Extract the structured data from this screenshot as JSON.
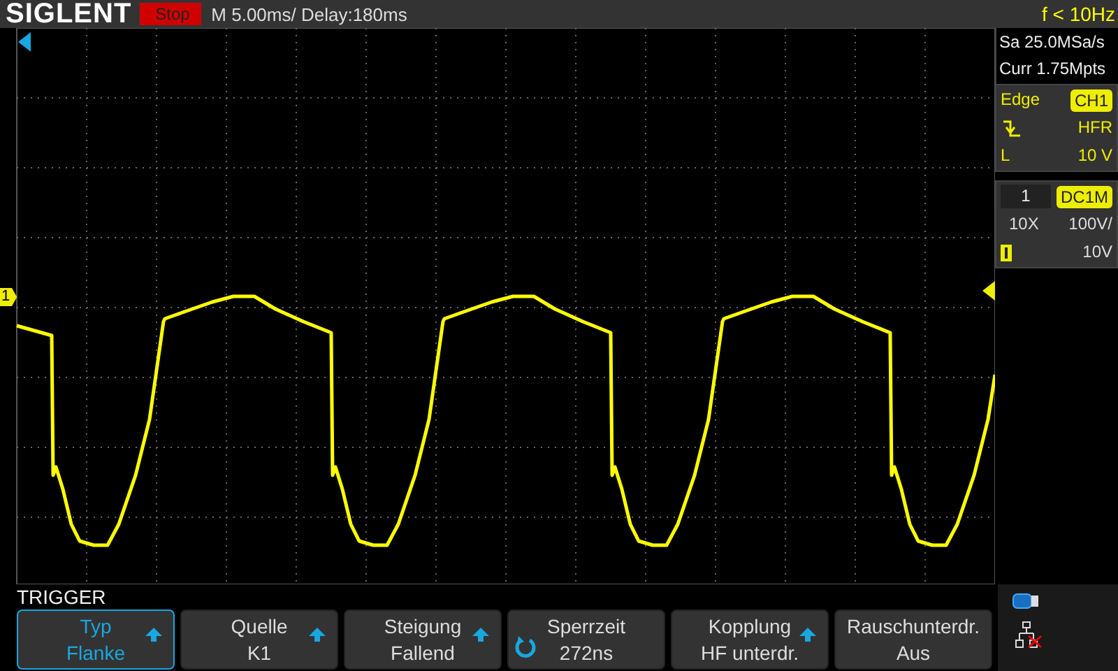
{
  "top_bar": {
    "logo": "SIGLENT",
    "run_state": "Stop",
    "timebase": "M 5.00ms/ Delay:180ms",
    "frequency": "f < 10Hz"
  },
  "acquisition": {
    "sample_rate": "Sa 25.0MSa/s",
    "memory": "Curr 1.75Mpts"
  },
  "trigger_panel": {
    "type": "Edge",
    "source": "CH1",
    "coupling": "HFR",
    "level_label": "L",
    "level": "10 V"
  },
  "channel_panel": {
    "number": "1",
    "coupling": "DC1M",
    "probe": "10X",
    "scale": "100V/",
    "offset": "10V"
  },
  "screen": {
    "channel_marker": "1"
  },
  "menu": {
    "title": "TRIGGER",
    "softkeys": [
      {
        "label": "Typ",
        "value": "Flanke",
        "selected": true,
        "kind": "arrow"
      },
      {
        "label": "Quelle",
        "value": "K1",
        "selected": false,
        "kind": "arrow"
      },
      {
        "label": "Steigung",
        "value": "Fallend",
        "selected": false,
        "kind": "arrow"
      },
      {
        "label": "Sperrzeit",
        "value": "272ns",
        "selected": false,
        "kind": "knob"
      },
      {
        "label": "Kopplung",
        "value": "HF unterdr.",
        "selected": false,
        "kind": "arrow"
      },
      {
        "label": "Rauschunterdr.",
        "value": "Aus",
        "selected": false,
        "kind": "plain"
      }
    ]
  }
}
